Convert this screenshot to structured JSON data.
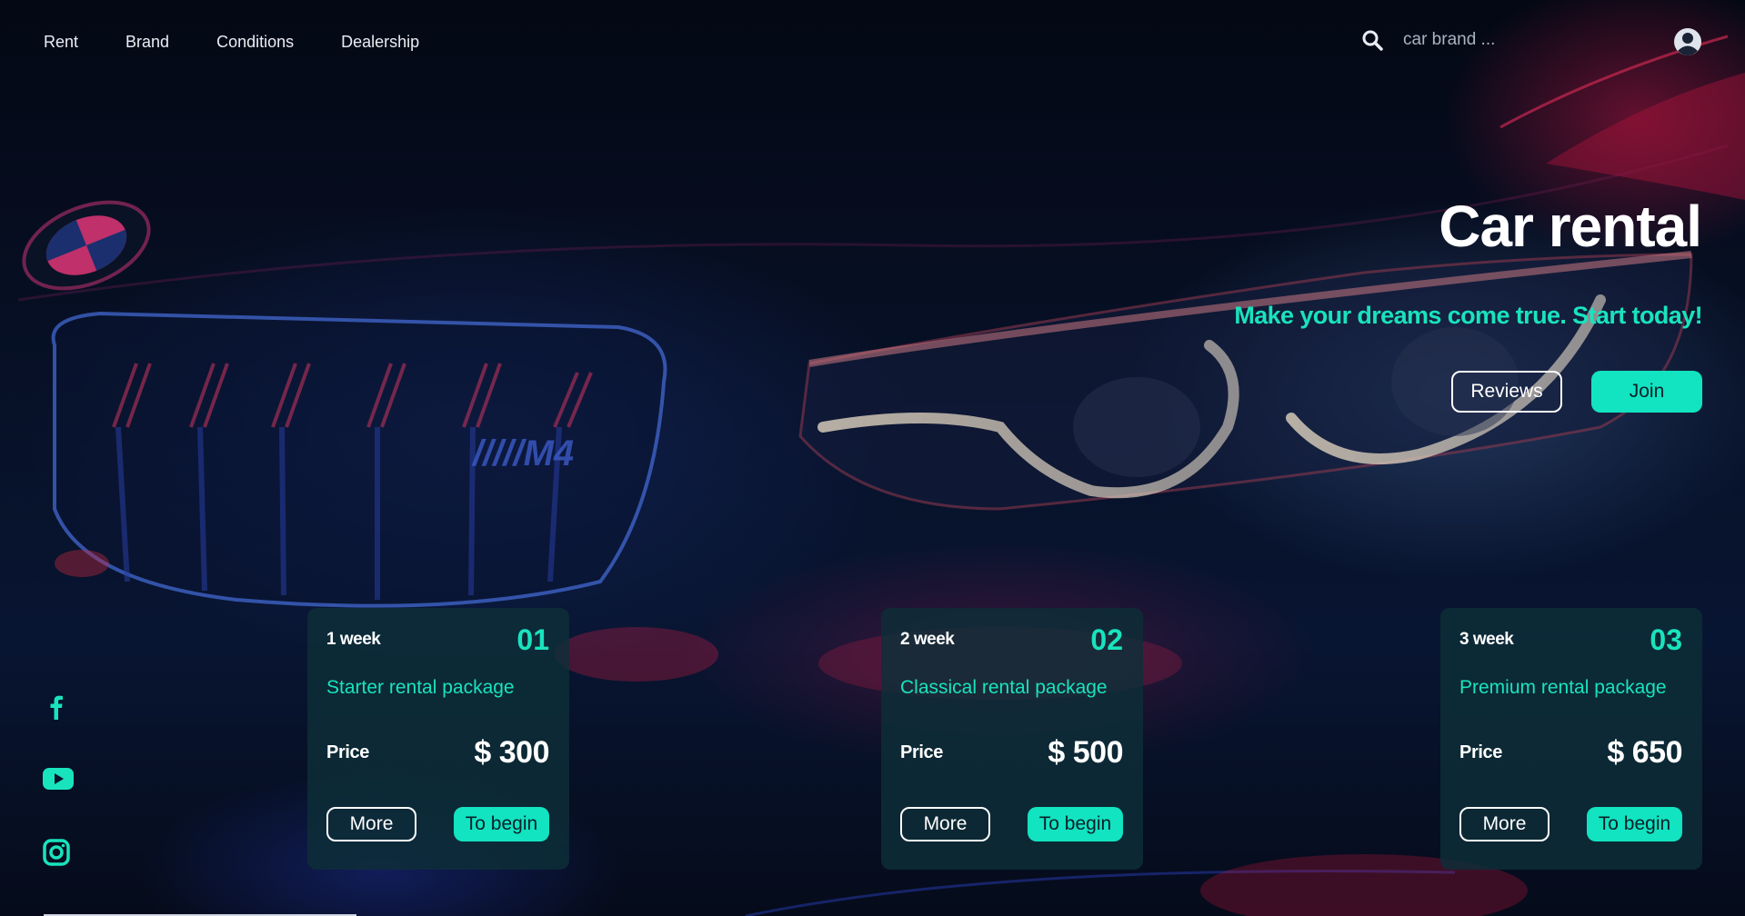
{
  "nav": {
    "items": [
      {
        "label": "Rent"
      },
      {
        "label": "Brand"
      },
      {
        "label": "Conditions"
      },
      {
        "label": "Dealership"
      }
    ]
  },
  "search": {
    "placeholder": "car brand ...",
    "icon": "search-icon"
  },
  "user": {
    "icon": "user-circle-icon"
  },
  "hero": {
    "title": "Car rental",
    "subtitle": "Make your dreams come true. Start today!",
    "reviews_label": "Reviews",
    "join_label": "Join"
  },
  "social": {
    "icons": [
      "facebook-icon",
      "youtube-icon",
      "instagram-icon"
    ]
  },
  "packages": [
    {
      "week": "1 week",
      "number": "01",
      "name": "Starter rental package",
      "price_label": "Price",
      "price": "$ 300",
      "more_label": "More",
      "begin_label": "To begin"
    },
    {
      "week": "2 week",
      "number": "02",
      "name": "Classical rental package",
      "price_label": "Price",
      "price": "$ 500",
      "more_label": "More",
      "begin_label": "To begin"
    },
    {
      "week": "3 week",
      "number": "03",
      "name": "Premium rental package",
      "price_label": "Price",
      "price": "$ 650",
      "more_label": "More",
      "begin_label": "To begin"
    }
  ],
  "colors": {
    "accent": "#12e3c0",
    "background": "#050b1a",
    "card": "#0e2e38"
  }
}
